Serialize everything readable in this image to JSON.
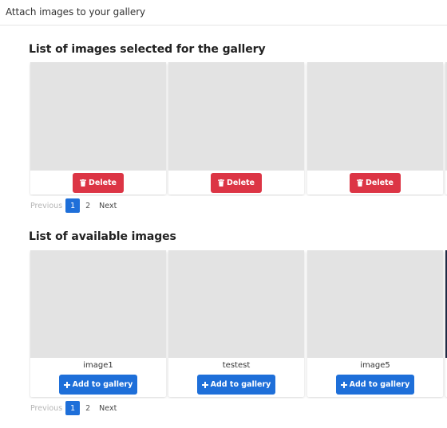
{
  "header": {
    "title": "Attach images to your gallery"
  },
  "selected": {
    "title": "List of images selected for the gallery",
    "delete_label": "Delete",
    "cards": [
      {
        "id": 1
      },
      {
        "id": 2
      },
      {
        "id": 3
      },
      {
        "id": 4
      }
    ],
    "pagination": {
      "previous": "Previous",
      "pages": [
        "1",
        "2"
      ],
      "current": "1",
      "next": "Next"
    }
  },
  "available": {
    "title": "List of available images",
    "add_label": "Add to gallery",
    "cards": [
      {
        "caption": "image1"
      },
      {
        "caption": "testest"
      },
      {
        "caption": "image5"
      },
      {
        "caption": ""
      }
    ],
    "pagination": {
      "previous": "Previous",
      "pages": [
        "1",
        "2"
      ],
      "current": "1",
      "next": "Next"
    }
  },
  "colors": {
    "delete": "#dc3545",
    "primary": "#1e6fd9",
    "placeholder": "#e3e3e3"
  },
  "icons": {
    "delete": "trash-icon",
    "add": "plus-icon"
  }
}
